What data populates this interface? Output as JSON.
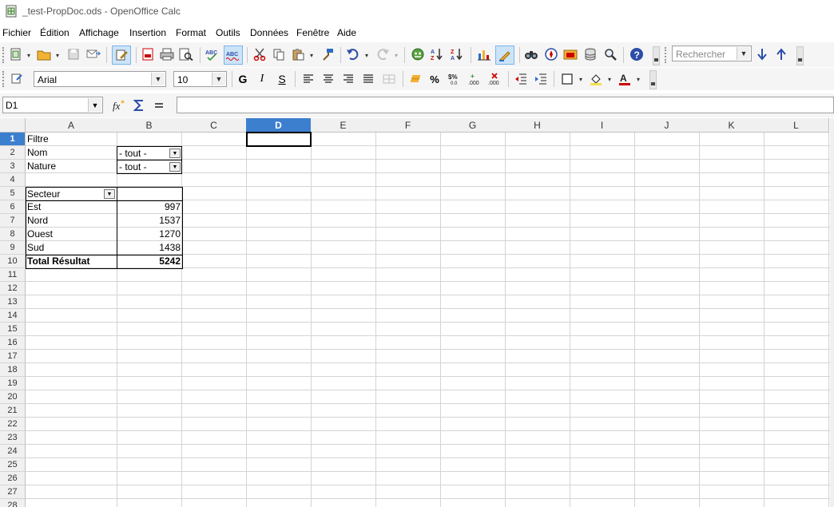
{
  "window": {
    "title": "_test-PropDoc.ods - OpenOffice Calc"
  },
  "menu": [
    "Fichier",
    "Édition",
    "Affichage",
    "Insertion",
    "Format",
    "Outils",
    "Données",
    "Fenêtre",
    "Aide"
  ],
  "toolbar": {
    "search_placeholder": "Rechercher",
    "font_name": "Arial",
    "font_size": "10",
    "bold": "G",
    "italic": "I",
    "underline": "S",
    "percent": "%"
  },
  "formula_bar": {
    "cell_ref": "D1",
    "formula": ""
  },
  "columns": [
    "A",
    "B",
    "C",
    "D",
    "E",
    "F",
    "G",
    "H",
    "I",
    "J",
    "K",
    "L"
  ],
  "rows": [
    "1",
    "2",
    "3",
    "4",
    "5",
    "6",
    "7",
    "8",
    "9",
    "10",
    "11",
    "12",
    "13",
    "14",
    "15",
    "16",
    "17",
    "18",
    "19",
    "20",
    "21",
    "22",
    "23",
    "24",
    "25",
    "26",
    "27",
    "28"
  ],
  "selected_cell": "D1",
  "sheet": {
    "filter_label": "Filtre",
    "filters": [
      {
        "field": "Nom",
        "value": "- tout -"
      },
      {
        "field": "Nature",
        "value": "- tout -"
      }
    ],
    "row_field": "Secteur",
    "data": [
      {
        "label": "Est",
        "value": "997"
      },
      {
        "label": "Nord",
        "value": "1537"
      },
      {
        "label": "Ouest",
        "value": "1270"
      },
      {
        "label": "Sud",
        "value": "1438"
      }
    ],
    "total": {
      "label": "Total Résultat",
      "value": "5242"
    }
  }
}
